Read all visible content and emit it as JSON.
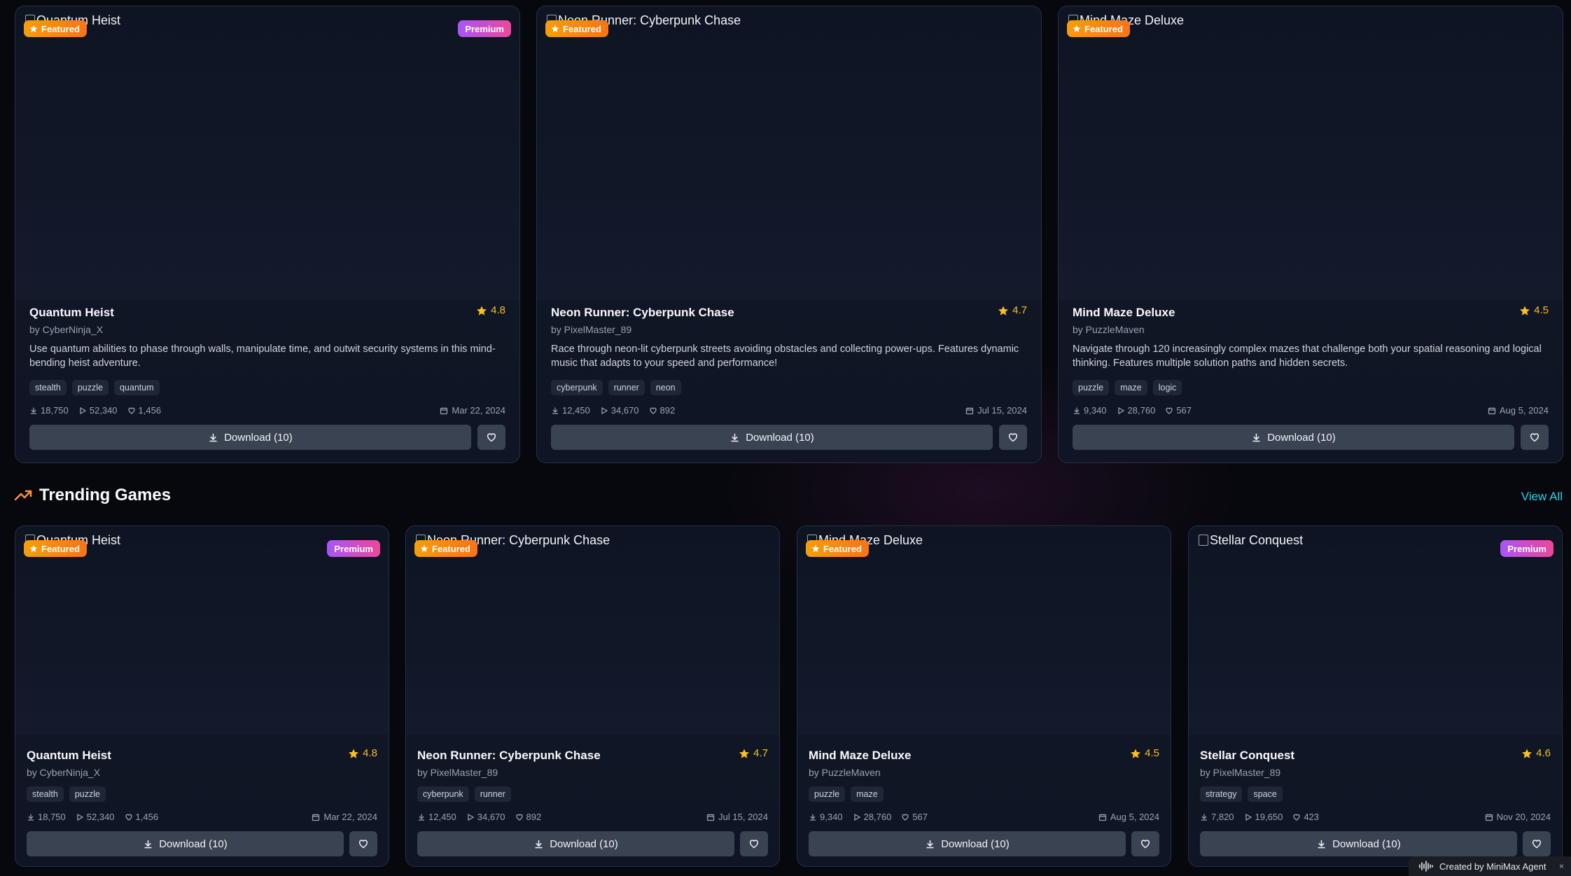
{
  "colors": {
    "background": "#07080d",
    "card": "#101726",
    "featured_badge": "#f59e0b",
    "premium_badge": "#a855f7",
    "star": "#fbbf24",
    "accent_link": "#22d3ee",
    "button": "#3a4352"
  },
  "featured": [
    {
      "image_alt": "Quantum Heist",
      "featured_label": "Featured",
      "premium_label": "Premium",
      "title": "Quantum Heist",
      "rating": "4.8",
      "author": "by CyberNinja_X",
      "description": "Use quantum abilities to phase through walls, manipulate time, and outwit security systems in this mind-bending heist adventure.",
      "tags": [
        "stealth",
        "puzzle",
        "quantum"
      ],
      "downloads": "18,750",
      "plays": "52,340",
      "likes": "1,456",
      "date": "Mar 22, 2024",
      "download_label": "Download (10)"
    },
    {
      "image_alt": "Neon Runner: Cyberpunk Chase",
      "featured_label": "Featured",
      "premium_label": "",
      "title": "Neon Runner: Cyberpunk Chase",
      "rating": "4.7",
      "author": "by PixelMaster_89",
      "description": "Race through neon-lit cyberpunk streets avoiding obstacles and collecting power-ups. Features dynamic music that adapts to your speed and performance!",
      "tags": [
        "cyberpunk",
        "runner",
        "neon"
      ],
      "downloads": "12,450",
      "plays": "34,670",
      "likes": "892",
      "date": "Jul 15, 2024",
      "download_label": "Download (10)"
    },
    {
      "image_alt": "Mind Maze Deluxe",
      "featured_label": "Featured",
      "premium_label": "",
      "title": "Mind Maze Deluxe",
      "rating": "4.5",
      "author": "by PuzzleMaven",
      "description": "Navigate through 120 increasingly complex mazes that challenge both your spatial reasoning and logical thinking. Features multiple solution paths and hidden secrets.",
      "tags": [
        "puzzle",
        "maze",
        "logic"
      ],
      "downloads": "9,340",
      "plays": "28,760",
      "likes": "567",
      "date": "Aug 5, 2024",
      "download_label": "Download (10)"
    }
  ],
  "trending": {
    "title": "Trending Games",
    "view_all": "View All",
    "games": [
      {
        "image_alt": "Quantum Heist",
        "featured_label": "Featured",
        "premium_label": "Premium",
        "title": "Quantum Heist",
        "rating": "4.8",
        "author": "by CyberNinja_X",
        "tags": [
          "stealth",
          "puzzle"
        ],
        "downloads": "18,750",
        "plays": "52,340",
        "likes": "1,456",
        "date": "Mar 22, 2024",
        "download_label": "Download (10)"
      },
      {
        "image_alt": "Neon Runner: Cyberpunk Chase",
        "featured_label": "Featured",
        "premium_label": "",
        "title": "Neon Runner: Cyberpunk Chase",
        "rating": "4.7",
        "author": "by PixelMaster_89",
        "tags": [
          "cyberpunk",
          "runner"
        ],
        "downloads": "12,450",
        "plays": "34,670",
        "likes": "892",
        "date": "Jul 15, 2024",
        "download_label": "Download (10)"
      },
      {
        "image_alt": "Mind Maze Deluxe",
        "featured_label": "Featured",
        "premium_label": "",
        "title": "Mind Maze Deluxe",
        "rating": "4.5",
        "author": "by PuzzleMaven",
        "tags": [
          "puzzle",
          "maze"
        ],
        "downloads": "9,340",
        "plays": "28,760",
        "likes": "567",
        "date": "Aug 5, 2024",
        "download_label": "Download (10)"
      },
      {
        "image_alt": "Stellar Conquest",
        "featured_label": "",
        "premium_label": "Premium",
        "title": "Stellar Conquest",
        "rating": "4.6",
        "author": "by PixelMaster_89",
        "tags": [
          "strategy",
          "space"
        ],
        "downloads": "7,820",
        "plays": "19,650",
        "likes": "423",
        "date": "Nov 20, 2024",
        "download_label": "Download (10)"
      }
    ]
  },
  "footer_badge": {
    "label": "Created by MiniMax Agent",
    "close": "×"
  }
}
